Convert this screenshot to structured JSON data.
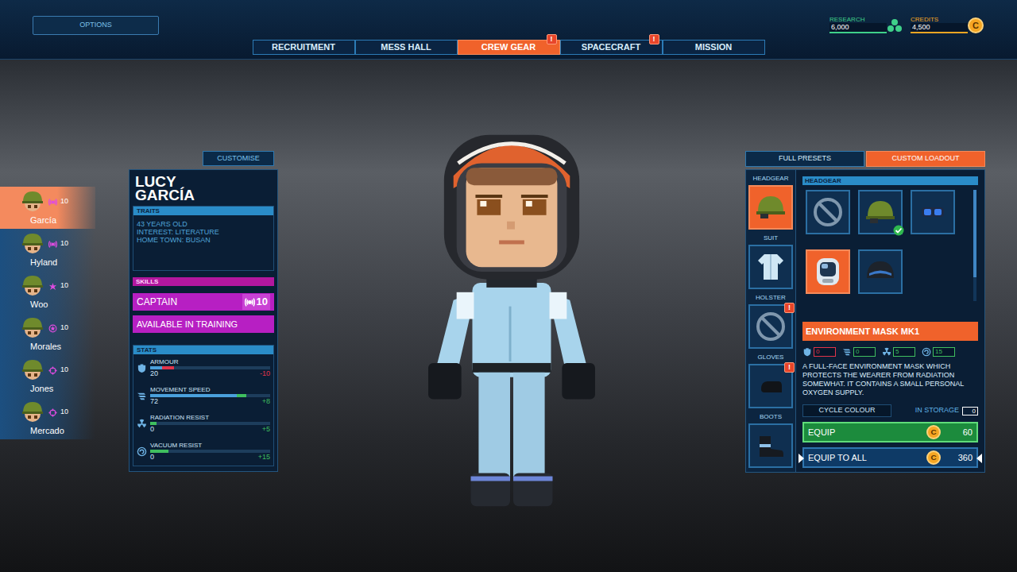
{
  "options_button": {
    "label": "OPTIONS"
  },
  "alert_mark": "!",
  "coin_symbol": "C",
  "tabs": [
    {
      "label": "RECRUITMENT",
      "selected": false,
      "alert": false
    },
    {
      "label": "MESS HALL",
      "selected": false,
      "alert": false
    },
    {
      "label": "CREW GEAR",
      "selected": true,
      "alert": true
    },
    {
      "label": "SPACECRAFT",
      "selected": false,
      "alert": true
    },
    {
      "label": "MISSION",
      "selected": false,
      "alert": false
    }
  ],
  "resources": [
    {
      "label": "RESEARCH",
      "value": "6,000",
      "kind": "research",
      "color": "#3fd08a"
    },
    {
      "label": "CREDITS",
      "value": "4,500",
      "kind": "credits",
      "color": "#f5a623"
    }
  ],
  "crew": [
    {
      "name": "García",
      "level": "10",
      "kind": "captain",
      "selected": true
    },
    {
      "name": "Hyland",
      "level": "10",
      "kind": "captain",
      "selected": false
    },
    {
      "name": "Woo",
      "level": "10",
      "kind": "medic",
      "selected": false
    },
    {
      "name": "Morales",
      "level": "10",
      "kind": "engineer",
      "selected": false
    },
    {
      "name": "Jones",
      "level": "10",
      "kind": "gunner",
      "selected": false
    },
    {
      "name": "Mercado",
      "level": "10",
      "kind": "gunner",
      "selected": false
    }
  ],
  "profile": {
    "tab": "CUSTOMISE",
    "name_lines": [
      "LUCY",
      "GARCÍA"
    ],
    "traits_header": "TRAITS",
    "traits": [
      "43 YEARS OLD",
      "INTEREST: LITERATURE",
      "HOME TOWN: BUSAN"
    ],
    "skills_header": "SKILLS",
    "skills": [
      {
        "label": "CAPTAIN",
        "level": "10",
        "kind": "captain"
      },
      {
        "label": "AVAILABLE IN TRAINING",
        "level": "",
        "kind": "training"
      }
    ],
    "stats_header": "STATS",
    "stats": [
      {
        "label": "ARMOUR",
        "value": "20",
        "change": "-10",
        "level": 0.2,
        "change_level": 0.1,
        "kind": "armour",
        "change_kind": "decrease",
        "color": "#e0344a"
      },
      {
        "label": "MOVEMENT SPEED",
        "value": "72",
        "change": "+8",
        "level": 0.72,
        "change_level": 0.08,
        "kind": "speed",
        "change_kind": "increase",
        "color": "#3fbf5f"
      },
      {
        "label": "RADIATION RESIST",
        "value": "0",
        "change": "+5",
        "level": 0,
        "change_level": 0.05,
        "kind": "radiation",
        "change_kind": "increase",
        "color": "#3fbf5f"
      },
      {
        "label": "VACUUM RESIST",
        "value": "0",
        "change": "+15",
        "level": 0,
        "change_level": 0.15,
        "kind": "vacuum",
        "change_kind": "increase",
        "color": "#3fbf5f"
      }
    ]
  },
  "loadout": {
    "tabs": [
      {
        "label": "FULL PRESETS",
        "selected": false
      },
      {
        "label": "CUSTOM LOADOUT",
        "selected": true
      }
    ],
    "slots": [
      {
        "label": "HEADGEAR",
        "kind": "helmet",
        "selected": true,
        "alert": false
      },
      {
        "label": "SUIT",
        "kind": "suit",
        "selected": false,
        "alert": false
      },
      {
        "label": "HOLSTER",
        "kind": "none",
        "selected": false,
        "alert": true
      },
      {
        "label": "GLOVES",
        "kind": "gloves",
        "selected": false,
        "alert": true
      },
      {
        "label": "BOOTS",
        "kind": "boots",
        "selected": false,
        "alert": false
      }
    ],
    "items_header": "HEADGEAR",
    "items": [
      {
        "kind": "none",
        "selected": false,
        "equipped": false
      },
      {
        "kind": "helmet",
        "selected": false,
        "equipped": true
      },
      {
        "kind": "goggles",
        "selected": false,
        "equipped": false
      },
      {
        "kind": "mask",
        "selected": true,
        "equipped": false
      },
      {
        "kind": "dark-helmet",
        "selected": false,
        "equipped": false
      }
    ],
    "selected_item": {
      "name": "ENVIRONMENT MASK MK1",
      "stats": [
        {
          "kind": "armour",
          "value": "0",
          "color": "#e0344a"
        },
        {
          "kind": "speed",
          "value": "0",
          "color": "#3fbf5f"
        },
        {
          "kind": "radiation",
          "value": "5",
          "color": "#3fbf5f"
        },
        {
          "kind": "vacuum",
          "value": "15",
          "color": "#3fbf5f"
        }
      ],
      "description": "A FULL-FACE ENVIRONMENT MASK WHICH PROTECTS THE WEARER FROM RADIATION SOMEWHAT. IT CONTAINS A SMALL PERSONAL OXYGEN SUPPLY."
    },
    "cycle_colour": "CYCLE COLOUR",
    "storage": {
      "label": "IN STORAGE",
      "value": "0"
    },
    "actions": [
      {
        "label": "EQUIP",
        "cost": "60",
        "kind": "equip"
      },
      {
        "label": "EQUIP TO ALL",
        "cost": "360",
        "kind": "equip-all"
      }
    ]
  }
}
